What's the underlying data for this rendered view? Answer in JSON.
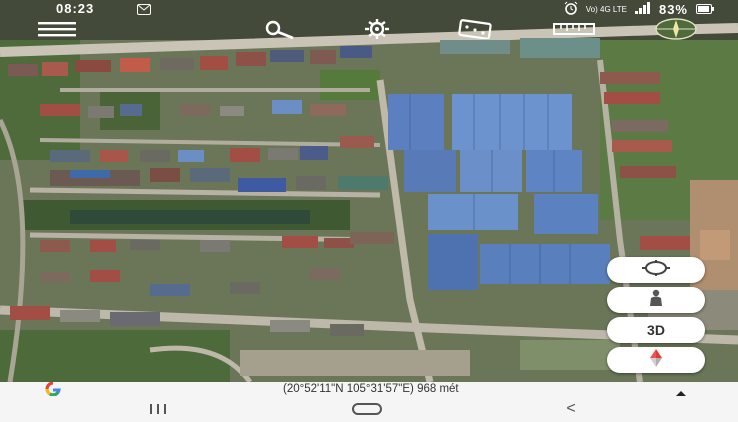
{
  "status_bar": {
    "time": "08:23",
    "network_label": "Vo) 4G LTE",
    "battery_percent": "83%",
    "icons": [
      "message-icon",
      "alarm-icon",
      "network-icon",
      "signal-icon",
      "battery-icon"
    ]
  },
  "toolbar": {
    "icons": [
      "menu-icon",
      "search-icon",
      "gear-icon",
      "dice-icon",
      "ruler-icon",
      "compass-icon"
    ]
  },
  "fab": {
    "my_location": "my-location-icon",
    "street_view": "street-view-icon",
    "three_d_label": "3D",
    "compass": "compass-icon"
  },
  "coordinates": {
    "text": "(20°52'11\"N 105°31'57\"E) 968 mét",
    "logo": "G"
  },
  "nav_bar": {
    "icons": [
      "recent-apps-icon",
      "home-icon",
      "back-icon"
    ],
    "back": "<"
  },
  "colors": {
    "roof_blue": "#5b7fbf",
    "vegetation": "#5f7a48",
    "road": "#b9b6ad",
    "bar_bg": "#f5f5f5"
  }
}
